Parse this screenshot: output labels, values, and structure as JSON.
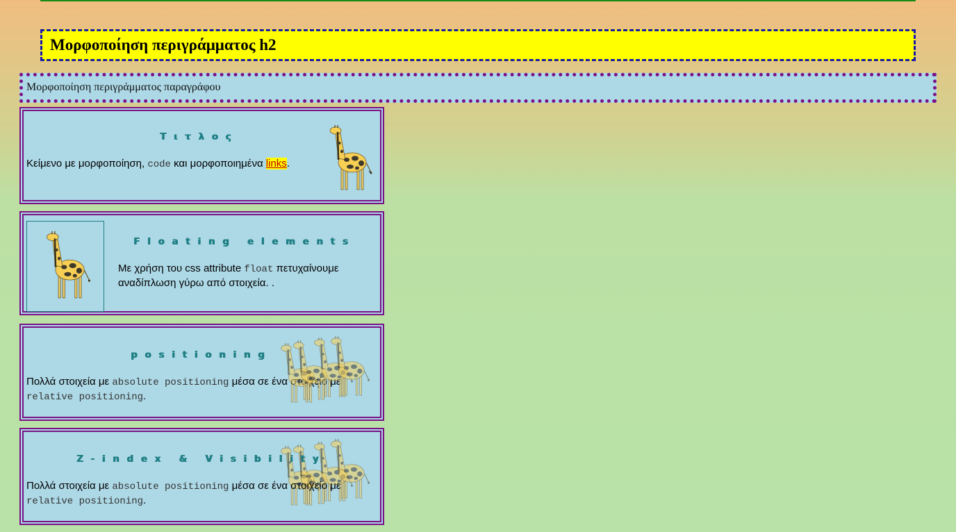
{
  "page": {
    "h2_title": "Μορφοποίηση περιγράμματος h2",
    "paragraph": "Μορφοποίηση περιγράμματος παραγράφου"
  },
  "cards": [
    {
      "title": "Τιτλος",
      "text_before": "Κείμενο με μορφοποίηση, ",
      "code": "code",
      "text_mid": " και μορφοποιημένα ",
      "link": "links",
      "text_after": ".",
      "trailing": "."
    },
    {
      "title": "Floating elements",
      "text_before": "Με χρήση του css attribute ",
      "code": "float",
      "text_after": " πετυχαίνουμε αναδίπλωση γύρω από στοιχεία. ."
    },
    {
      "title": "positioning",
      "text_before": "Πολλά στοιχεία με ",
      "code1": "absolute positioning",
      "text_mid": " μέσα σε ένα στοιχείο με ",
      "code2": "relative positioning",
      "text_after": "."
    },
    {
      "title": "Z-index & Visibility",
      "text_before": "Πολλά στοιχεία με ",
      "code1": "absolute positioning",
      "text_mid": " μέσα σε ένα στοιχείο με ",
      "code2": "relative positioning",
      "text_after": "."
    }
  ],
  "icons": [
    "giraffe-icon"
  ],
  "colors": {
    "h2_background": "#ffff00",
    "card_background": "#add8e6",
    "border_purple": "#7a1185",
    "title_teal": "#1e7f84",
    "link_color": "#c00000"
  }
}
